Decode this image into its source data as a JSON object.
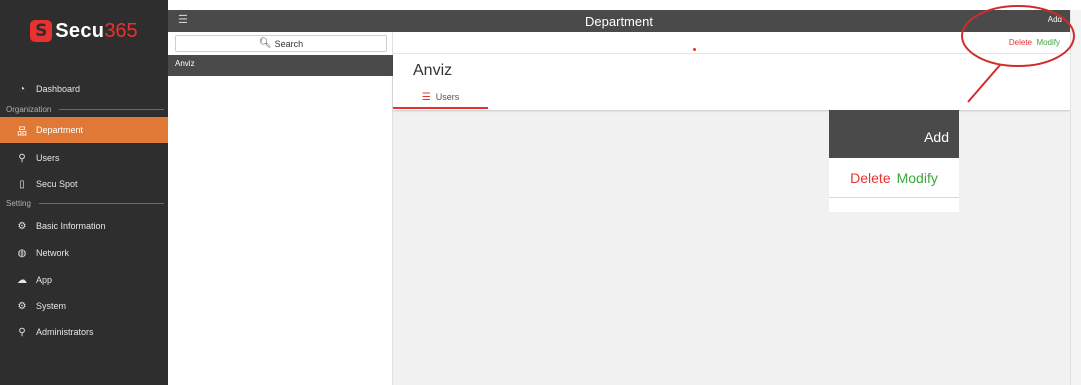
{
  "logo": {
    "mark": "S",
    "brand_part1": "Secu",
    "brand_part2": "365"
  },
  "sidebar": {
    "items": [
      {
        "label": "Dashboard",
        "icon": "dashboard-icon"
      },
      {
        "label": "Department",
        "icon": "department-icon",
        "active": true
      },
      {
        "label": "Users",
        "icon": "users-icon"
      },
      {
        "label": "Secu Spot",
        "icon": "device-icon"
      },
      {
        "label": "Basic Information",
        "icon": "gear-icon"
      },
      {
        "label": "Network",
        "icon": "globe-icon"
      },
      {
        "label": "App",
        "icon": "cloud-icon"
      },
      {
        "label": "System",
        "icon": "gear-icon"
      },
      {
        "label": "Administrators",
        "icon": "admin-icon"
      }
    ],
    "sections": {
      "organization": "Organization",
      "setting": "Setting"
    }
  },
  "topbar": {
    "title": "Department",
    "add_label": "Add",
    "menu_icon": "hamburger-icon"
  },
  "department_panel": {
    "search_placeholder": "Search",
    "search_icon": "search-icon",
    "items": [
      "Anviz"
    ]
  },
  "toolbar": {
    "delete_label": "Delete",
    "modify_label": "Modify"
  },
  "main": {
    "title": "Anviz",
    "tabs": [
      {
        "label": "Users",
        "icon": "list-icon"
      }
    ]
  },
  "zoom_callout": {
    "add_label": "Add",
    "delete_label": "Delete",
    "modify_label": "Modify"
  },
  "colors": {
    "accent": "#e07936",
    "brand_red": "#e8322f",
    "success_green": "#3aa83a",
    "dark_bar": "#4a4a4a",
    "sidebar_bg": "#2e2e2e"
  }
}
